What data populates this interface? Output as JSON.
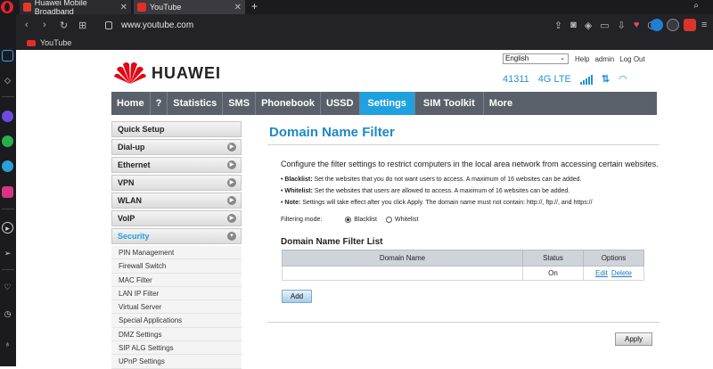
{
  "browser": {
    "tabs": [
      {
        "title": "Huawei Mobile Broadband",
        "fav_color": "#e33b2b"
      },
      {
        "title": "YouTube",
        "fav_color": "#e52d27"
      }
    ],
    "new_tab": "+",
    "url": "www.youtube.com",
    "bookmark": "YouTube"
  },
  "router": {
    "brand": "HUAWEI",
    "language": "English",
    "top_links": [
      "Help",
      "admin",
      "Log Out"
    ],
    "status": {
      "operator": "41311",
      "network": "4G LTE",
      "signal_level": 5
    },
    "nav": [
      "Home",
      "?",
      "Statistics",
      "SMS",
      "Phonebook",
      "USSD",
      "Settings",
      "SIM Toolkit",
      "More"
    ],
    "nav_active": "Settings",
    "menu": {
      "sections": [
        "Quick Setup",
        "Dial-up",
        "Ethernet",
        "VPN",
        "WLAN",
        "VoIP",
        "Security"
      ],
      "security_items": [
        "PIN Management",
        "Firewall Switch",
        "MAC Filter",
        "LAN IP Filter",
        "Virtual Server",
        "Special Applications",
        "DMZ Settings",
        "SIP ALG Settings",
        "UPnP Settings"
      ]
    },
    "page": {
      "title": "Domain Name Filter",
      "description": "Configure the filter settings to restrict computers in the local area network from accessing certain websites.",
      "bullets": [
        {
          "label": "Blacklist:",
          "text": " Set the websites that you do not want users to access. A maximum of 16 websites can be added."
        },
        {
          "label": "Whitelist:",
          "text": " Set the websites that users are allowed to access. A maximum of 16 websites can be added."
        },
        {
          "label": "Note:",
          "text": " Settings will take effect after you click Apply. The domain name must not contain: http://, ftp://, and https://"
        }
      ],
      "mode_label": "Filtering mode:",
      "mode_options": [
        "Blacklist",
        "Whitelist"
      ],
      "mode_selected": "Blacklist",
      "list_title": "Domain Name Filter List",
      "table": {
        "headers": [
          "Domain Name",
          "Status",
          "Options"
        ],
        "rows": [
          {
            "domain": "",
            "status": "On",
            "edit": "Edit",
            "delete": "Delete"
          }
        ]
      },
      "add_label": "Add",
      "apply_label": "Apply"
    }
  }
}
